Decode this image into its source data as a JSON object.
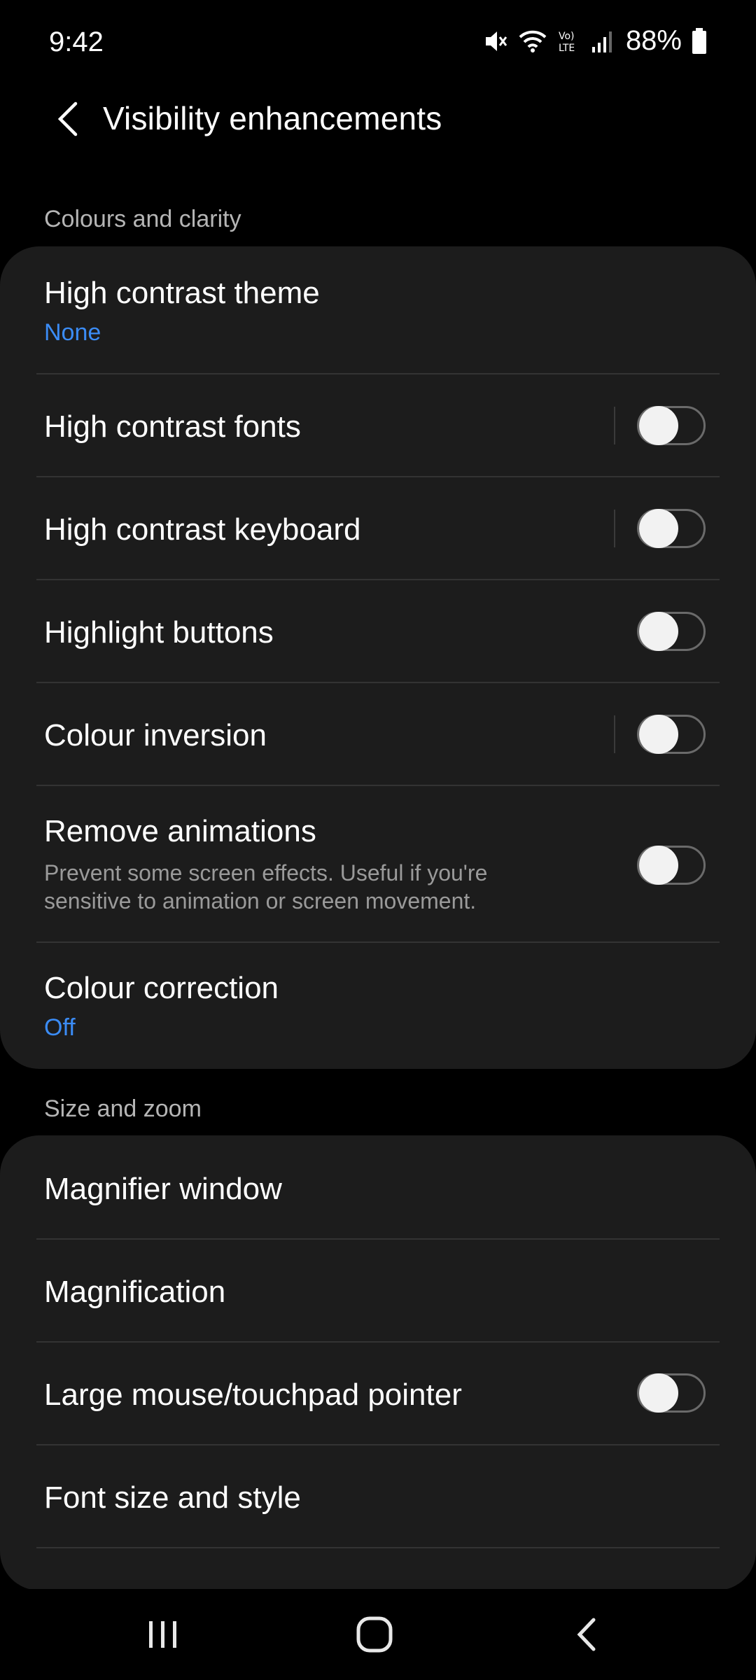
{
  "status": {
    "time": "9:42",
    "battery": "88%",
    "icons": [
      "mute-icon",
      "wifi-icon",
      "volte-icon",
      "signal-icon",
      "battery-icon"
    ]
  },
  "header": {
    "title": "Visibility enhancements",
    "back_icon": "back-arrow-icon"
  },
  "sections": [
    {
      "label": "Colours and clarity",
      "items": [
        {
          "title": "High contrast theme",
          "subtitle": "None"
        },
        {
          "title": "High contrast fonts",
          "toggle": false
        },
        {
          "title": "High contrast keyboard",
          "toggle": false
        },
        {
          "title": "Highlight buttons",
          "toggle": false
        },
        {
          "title": "Colour inversion",
          "toggle": false
        },
        {
          "title": "Remove animations",
          "description": "Prevent some screen effects. Useful if you're sensitive to animation or screen movement.",
          "toggle": false
        },
        {
          "title": "Colour correction",
          "subtitle": "Off"
        }
      ]
    },
    {
      "label": "Size and zoom",
      "items": [
        {
          "title": "Magnifier window"
        },
        {
          "title": "Magnification"
        },
        {
          "title": "Large mouse/touchpad pointer",
          "toggle": false
        },
        {
          "title": "Font size and style"
        }
      ]
    }
  ],
  "nav": {
    "recents_icon": "recents-icon",
    "home_icon": "home-icon",
    "back_icon": "back-icon"
  },
  "colors": {
    "accent": "#3b8cf5",
    "card": "#1c1c1c",
    "background": "#000000"
  }
}
